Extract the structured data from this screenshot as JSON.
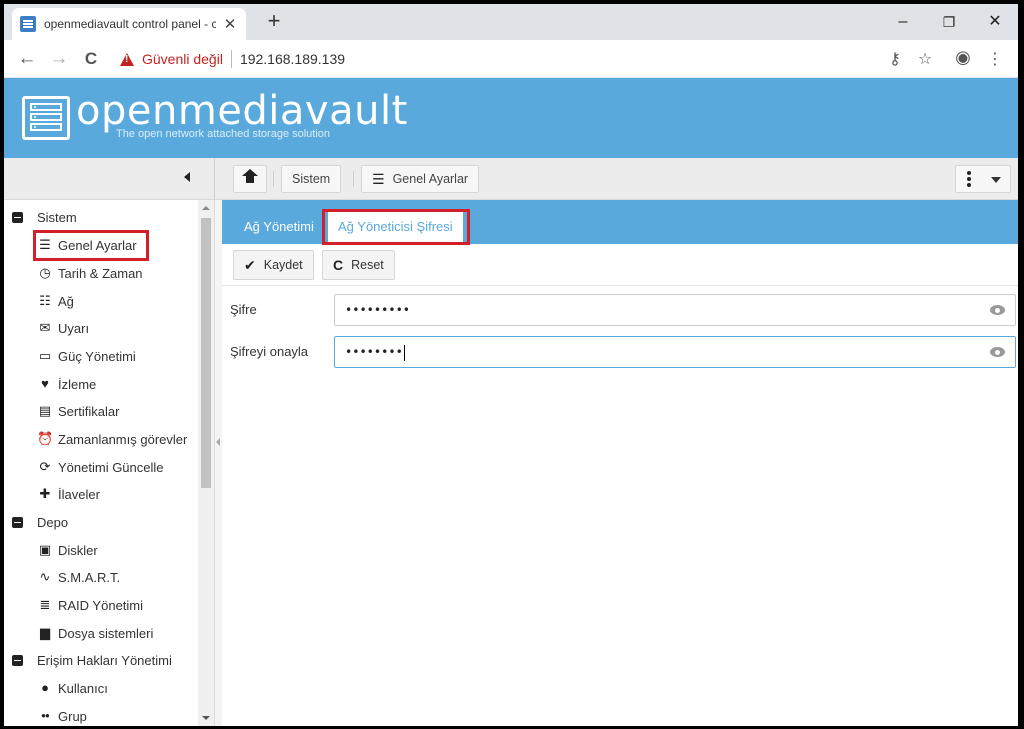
{
  "browser": {
    "tab_title": "openmediavault control panel - c",
    "tab_close": "✕",
    "new_tab": "+",
    "window_controls": {
      "minimize": "–",
      "restore": "❐",
      "close": "✕"
    },
    "nav": {
      "back": "←",
      "forward": "→",
      "reload": "C"
    },
    "security_label": "Güvenli değil",
    "url": "192.168.189.139",
    "address_icons": {
      "key": "⚷",
      "star": "☆",
      "profile": "◉",
      "menu": "⋮"
    }
  },
  "app": {
    "brand": "openmediavault",
    "tagline": "The open network attached storage solution"
  },
  "breadcrumb": {
    "items": [
      {
        "label": "Sistem"
      },
      {
        "label": "Genel Ayarlar"
      }
    ]
  },
  "sidebar": {
    "groups": [
      {
        "label": "Sistem",
        "items": [
          {
            "label": "Genel Ayarlar",
            "icon": "sliders-icon",
            "glyph": "☰"
          },
          {
            "label": "Tarih & Zaman",
            "icon": "clock-icon",
            "glyph": "◷"
          },
          {
            "label": "Ağ",
            "icon": "network-icon",
            "glyph": "☷"
          },
          {
            "label": "Uyarı",
            "icon": "envelope-icon",
            "glyph": "✉"
          },
          {
            "label": "Güç Yönetimi",
            "icon": "battery-icon",
            "glyph": "▭"
          },
          {
            "label": "İzleme",
            "icon": "heartbeat-icon",
            "glyph": "♥"
          },
          {
            "label": "Sertifikalar",
            "icon": "certificate-icon",
            "glyph": "▤"
          },
          {
            "label": "Zamanlanmış görevler",
            "icon": "alarm-clock-icon",
            "glyph": "⏰"
          },
          {
            "label": "Yönetimi Güncelle",
            "icon": "refresh-icon",
            "glyph": "⟳"
          },
          {
            "label": "İlaveler",
            "icon": "puzzle-icon",
            "glyph": "✚"
          }
        ]
      },
      {
        "label": "Depo",
        "items": [
          {
            "label": "Diskler",
            "icon": "disk-icon",
            "glyph": "▣"
          },
          {
            "label": "S.M.A.R.T.",
            "icon": "pulse-icon",
            "glyph": "∿"
          },
          {
            "label": "RAID Yönetimi",
            "icon": "database-icon",
            "glyph": "≣"
          },
          {
            "label": "Dosya sistemleri",
            "icon": "folder-icon",
            "glyph": "▆"
          }
        ]
      },
      {
        "label": "Erişim Hakları Yönetimi",
        "items": [
          {
            "label": "Kullanıcı",
            "icon": "user-icon",
            "glyph": "●"
          },
          {
            "label": "Grup",
            "icon": "group-icon",
            "glyph": "●●"
          }
        ]
      }
    ]
  },
  "main": {
    "tabs": [
      {
        "label": "Ağ Yönetimi",
        "active": false
      },
      {
        "label": "Ağ Yöneticisi Şifresi",
        "active": true
      }
    ],
    "actions": {
      "save_label": "Kaydet",
      "save_glyph": "✔",
      "reset_label": "Reset",
      "reset_glyph": "C"
    },
    "form": {
      "password_label": "Şifre",
      "password_value": "•••••••••",
      "confirm_label": "Şifreyi onayla",
      "confirm_value": "••••••••"
    }
  },
  "colors": {
    "accent": "#5aa9dd",
    "highlight_box": "#d21f2a",
    "warning": "#c5221f"
  }
}
